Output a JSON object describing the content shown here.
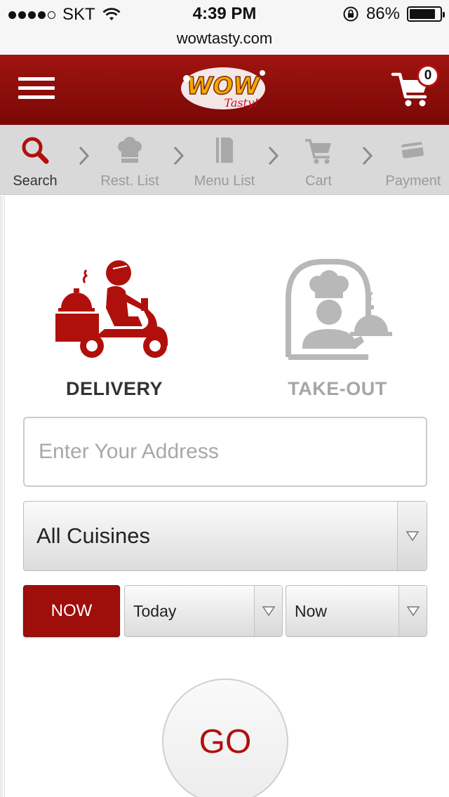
{
  "status_bar": {
    "carrier": "SKT",
    "time": "4:39 PM",
    "battery": "86%",
    "battery_level": 0.86
  },
  "url_bar": {
    "url": "wowtasty.com"
  },
  "header": {
    "menu_icon": "hamburger-icon",
    "logo_text": "WOW Tasty!",
    "cart_icon": "shopping-cart-icon",
    "cart_count": "0"
  },
  "steps": [
    {
      "label": "Search",
      "icon": "search-icon",
      "active": true
    },
    {
      "label": "Rest. List",
      "icon": "chef-hat-icon",
      "active": false
    },
    {
      "label": "Menu List",
      "icon": "menu-book-icon",
      "active": false
    },
    {
      "label": "Cart",
      "icon": "cart-icon",
      "active": false
    },
    {
      "label": "Payment",
      "icon": "credit-card-icon",
      "active": false
    }
  ],
  "modes": {
    "delivery": {
      "label": "DELIVERY",
      "icon": "delivery-scooter-icon",
      "selected": true
    },
    "takeout": {
      "label": "TAKE-OUT",
      "icon": "chef-serving-icon",
      "selected": false
    }
  },
  "address": {
    "placeholder": "Enter Your Address",
    "value": ""
  },
  "cuisine": {
    "selected": "All Cuisines"
  },
  "time_controls": {
    "now_label": "NOW",
    "day_selected": "Today",
    "time_selected": "Now"
  },
  "go_label": "GO",
  "colors": {
    "brand_red": "#9e0e0b",
    "header_red": "#a0140f",
    "inactive_gray": "#9a9a9a"
  }
}
